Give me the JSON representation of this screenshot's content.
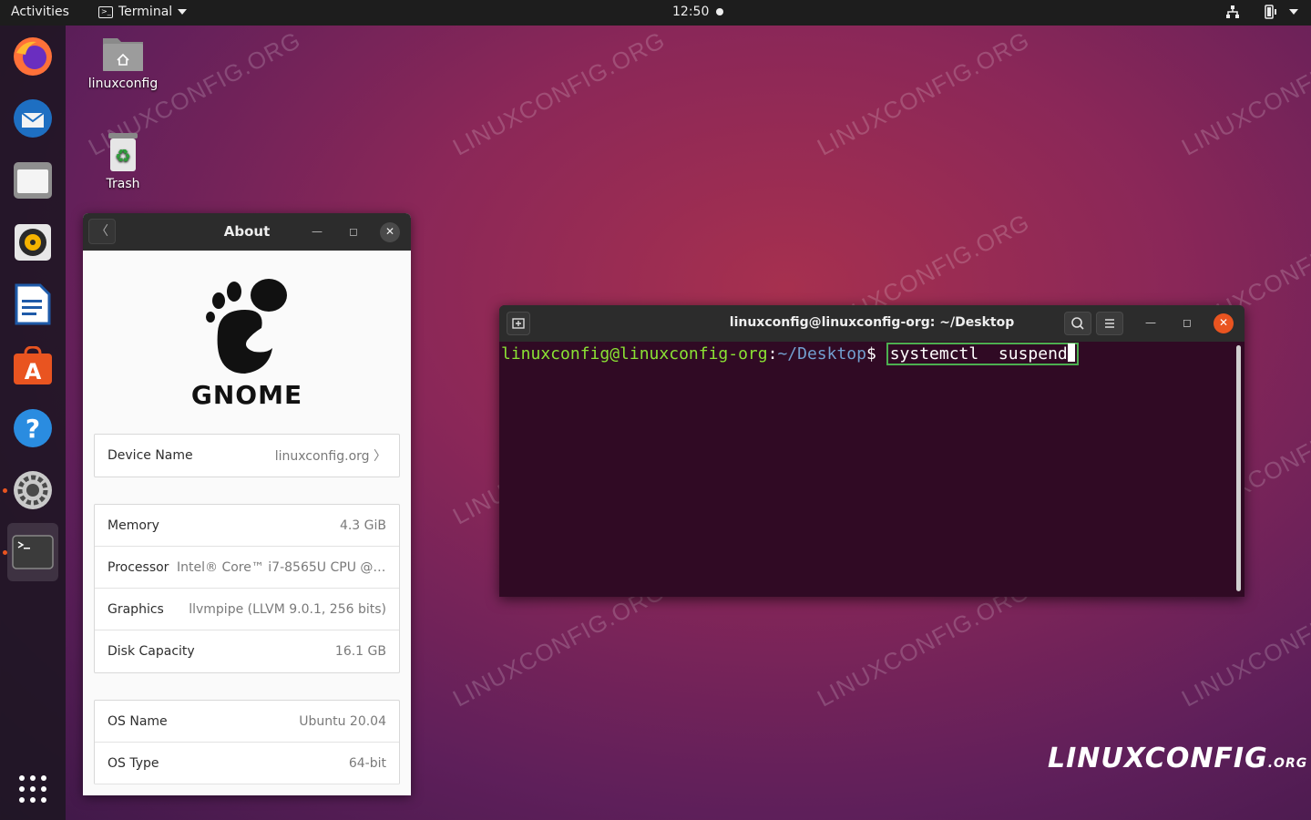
{
  "topbar": {
    "activities": "Activities",
    "app_menu": "Terminal",
    "clock": "12:50"
  },
  "dock": {
    "apps": [
      "firefox-icon",
      "thunderbird-icon",
      "files-icon",
      "rhythmbox-icon",
      "libreoffice-writer-icon",
      "software-icon",
      "help-icon",
      "settings-icon",
      "terminal-icon"
    ],
    "show_apps": "show-applications-icon"
  },
  "desktop": {
    "home_label": "linuxconfig",
    "trash_label": "Trash"
  },
  "watermark": "LINUXCONFIG.ORG",
  "about": {
    "title": "About",
    "logo_text": "GNOME",
    "device": {
      "label": "Device Name",
      "value": "linuxconfig.org"
    },
    "hardware": [
      {
        "label": "Memory",
        "value": "4.3 GiB"
      },
      {
        "label": "Processor",
        "value": "Intel® Core™ i7-8565U CPU @ 1…"
      },
      {
        "label": "Graphics",
        "value": "llvmpipe (LLVM 9.0.1, 256 bits)"
      },
      {
        "label": "Disk Capacity",
        "value": "16.1 GB"
      }
    ],
    "os": [
      {
        "label": "OS Name",
        "value": "Ubuntu 20.04"
      },
      {
        "label": "OS Type",
        "value": "64-bit"
      }
    ]
  },
  "terminal": {
    "title": "linuxconfig@linuxconfig-org: ~/Desktop",
    "prompt_user": "linuxconfig@linuxconfig-org",
    "prompt_sep": ":",
    "prompt_path": "~/Desktop",
    "prompt_end": "$",
    "command": "systemctl  suspend"
  },
  "brand": {
    "main": "LINUXCONFIG",
    "suffix": ".ORG"
  },
  "colors": {
    "accent": "#e95420",
    "terminal_bg": "#300a24",
    "prompt_user": "#8ae234",
    "prompt_path": "#729fcf"
  }
}
